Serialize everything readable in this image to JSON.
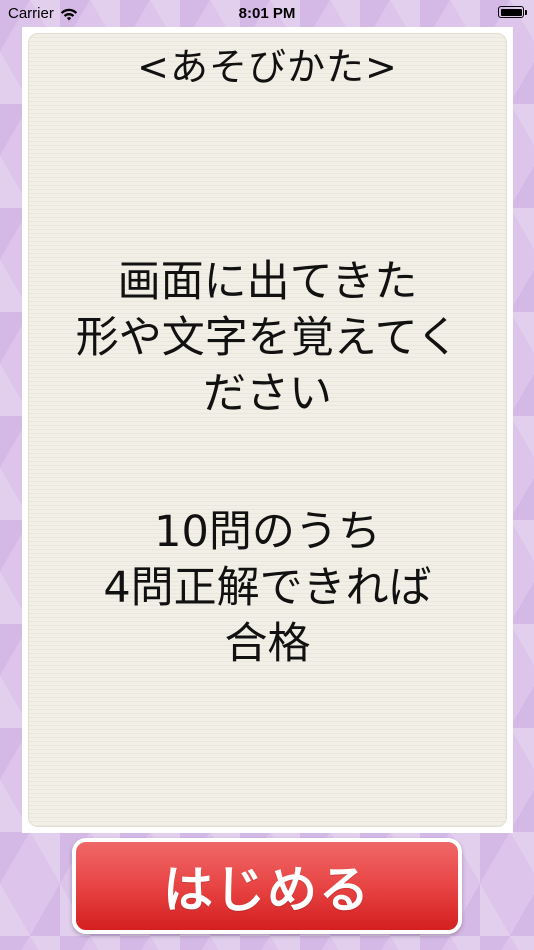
{
  "status_bar": {
    "carrier": "Carrier",
    "time": "8:01 PM",
    "icons": [
      "wifi-icon",
      "battery-icon"
    ]
  },
  "card": {
    "title": "<あそびかた>",
    "instructions": [
      "画面に出てきた",
      "形や文字を覚えてく",
      "ださい"
    ],
    "rules": [
      "10問のうち",
      "4問正解できれば",
      "合格"
    ]
  },
  "start_button": {
    "label": "はじめる"
  },
  "colors": {
    "background": "#dcc4ea",
    "card": "#f2efe6",
    "button": "#e84444",
    "button_text": "#ffffff"
  }
}
